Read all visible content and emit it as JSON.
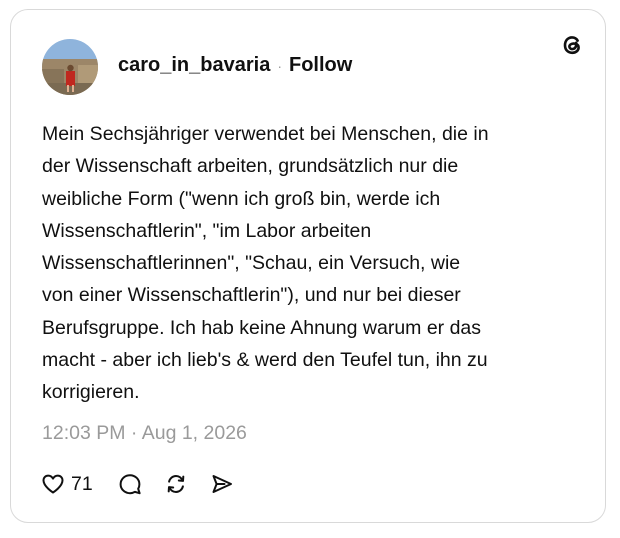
{
  "post": {
    "username": "caro_in_bavaria",
    "separator": "·",
    "follow_label": "Follow",
    "text": "Mein Sechsjähriger verwendet bei Menschen, die in\nder Wissenschaft arbeiten, grundsätzlich nur die\nweibliche Form (\"wenn ich groß bin, werde ich\nWissenschaftlerin\", \"im Labor arbeiten\nWissenschaftlerinnen\", \"Schau, ein Versuch, wie\nvon einer Wissenschaftlerin\"), und nur bei dieser\nBerufsgruppe. Ich hab keine Ahnung warum er das\nmacht - aber ich lieb's & werd den Teufel tun, ihn zu\nkorrigieren.",
    "timestamp": "12:03 PM · Aug 1, 2026",
    "like_count": "71"
  },
  "icons": {
    "brand": "threads-logo-icon",
    "like": "heart-icon",
    "reply": "comment-icon",
    "repost": "repost-icon",
    "share": "send-icon"
  },
  "colors": {
    "text": "#101010",
    "muted": "#9a9a9a",
    "border": "#d9d9d9",
    "background": "#ffffff"
  }
}
